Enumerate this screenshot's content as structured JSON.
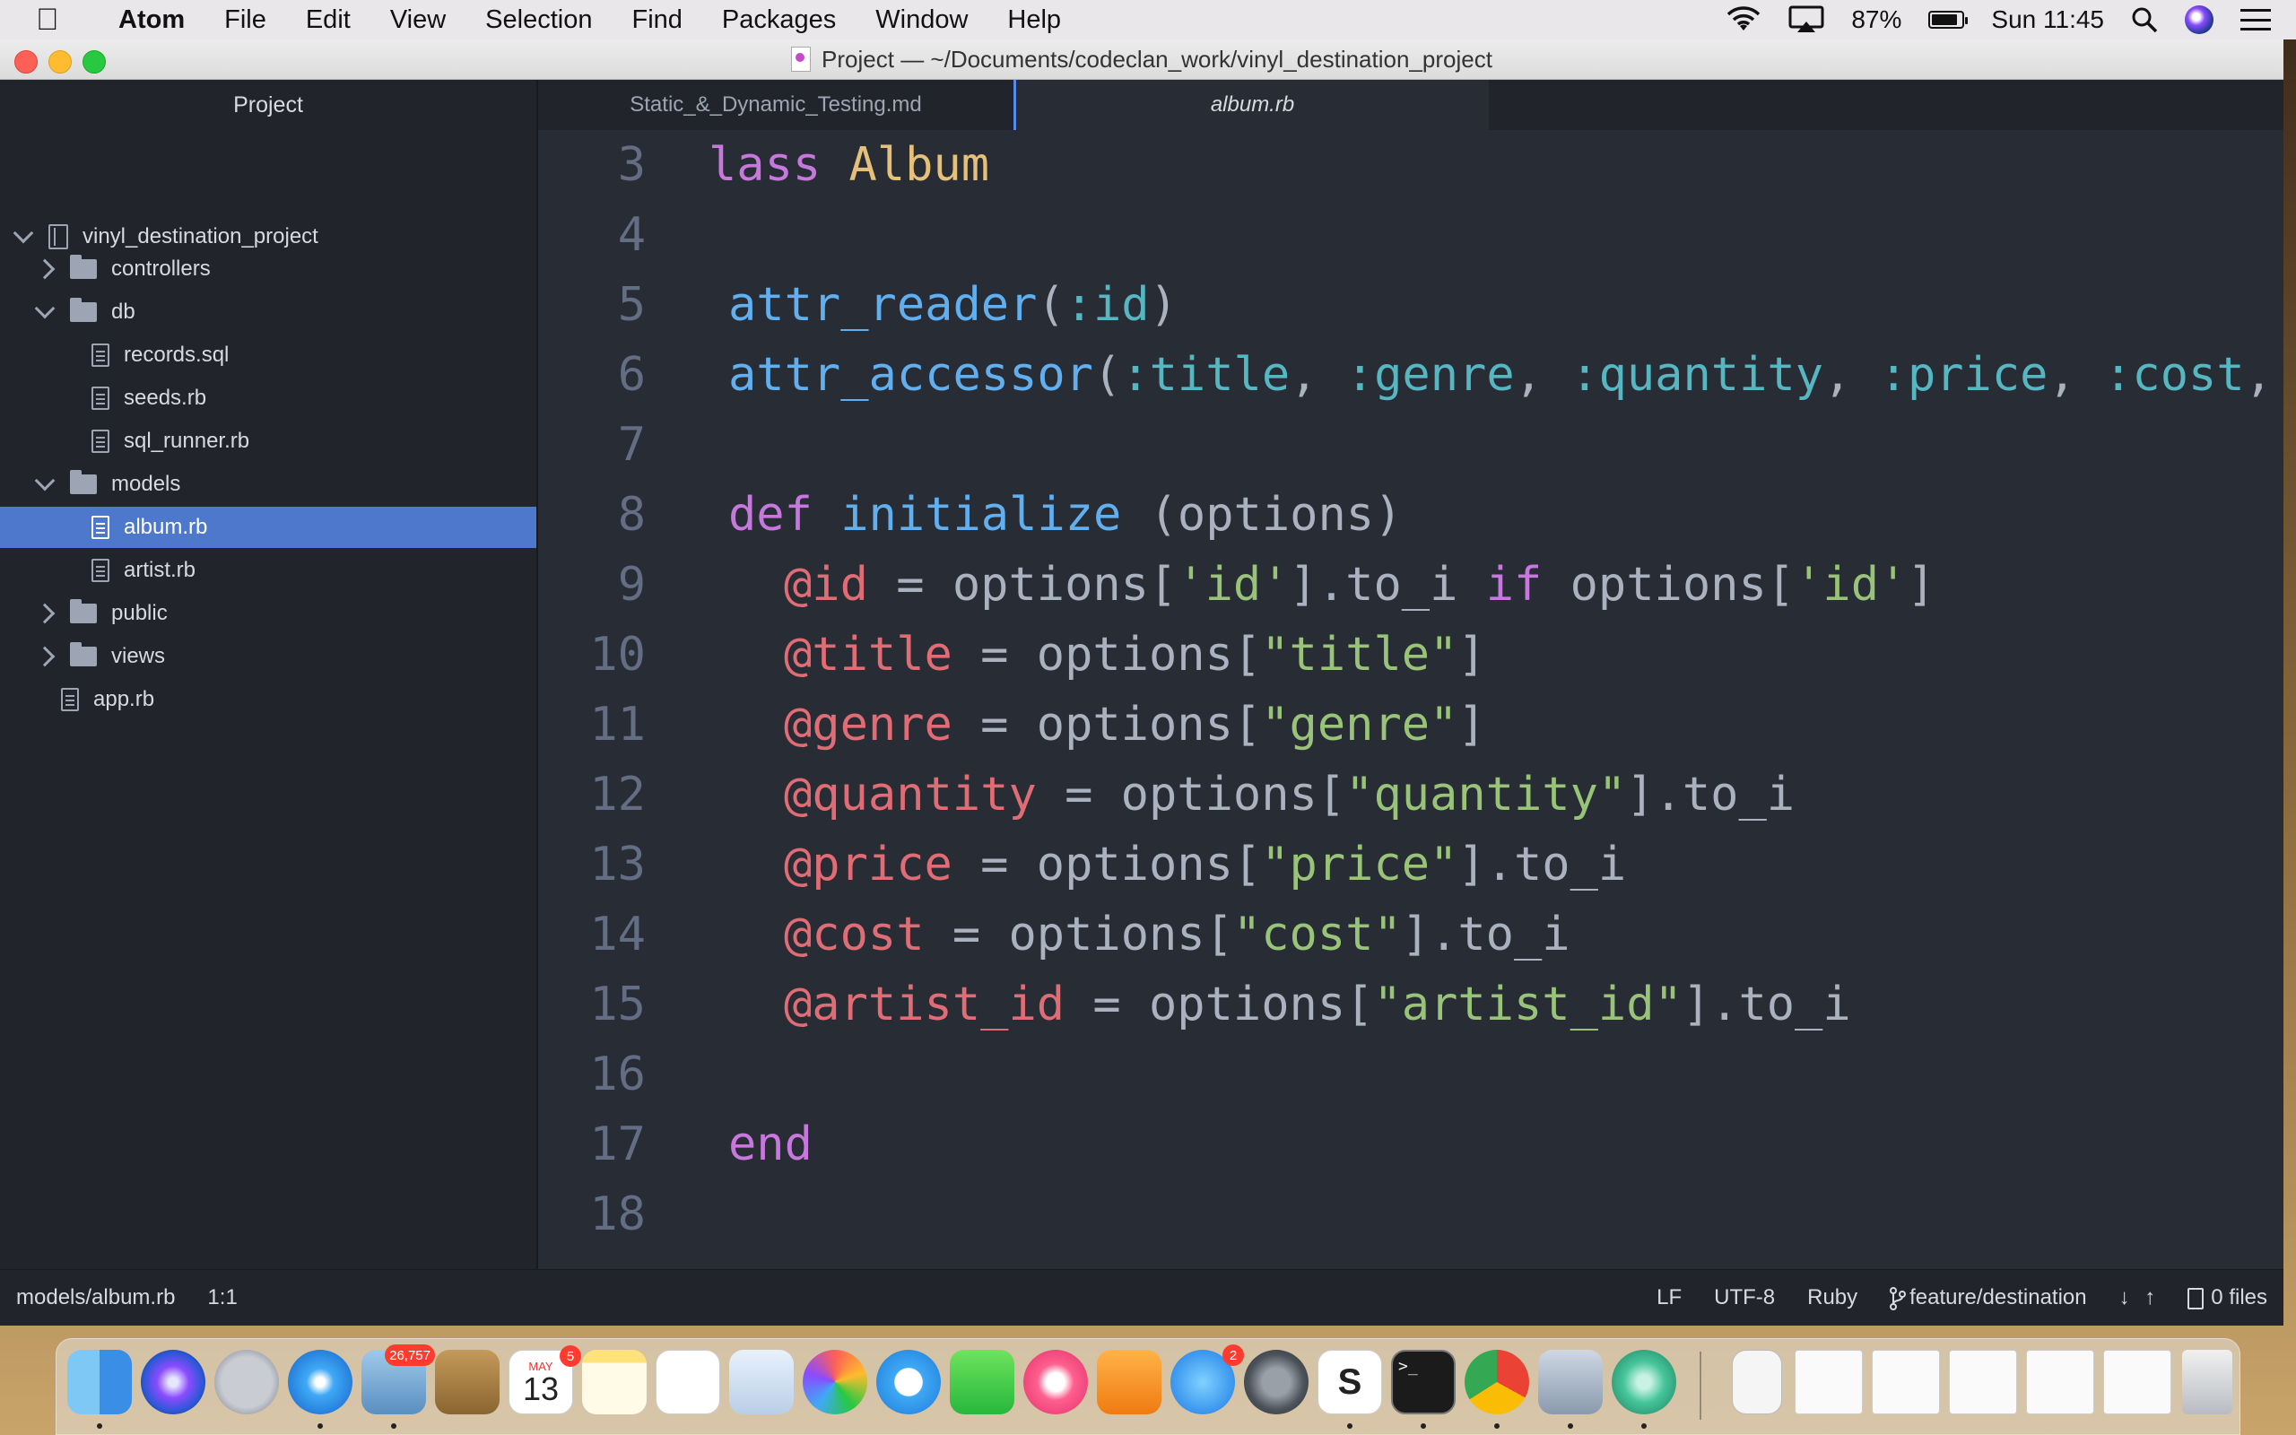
{
  "menubar": {
    "apple": "",
    "app": "Atom",
    "items": [
      "File",
      "Edit",
      "View",
      "Selection",
      "Find",
      "Packages",
      "Window",
      "Help"
    ],
    "battery": "87%",
    "battery_level": 0.87,
    "clock": "Sun 11:45"
  },
  "window": {
    "title": "Project — ~/Documents/codeclan_work/vinyl_destination_project"
  },
  "sidebar": {
    "header": "Project",
    "root": "vinyl_destination_project",
    "items": [
      {
        "label": "controllers",
        "type": "folder",
        "expanded": false
      },
      {
        "label": "db",
        "type": "folder",
        "expanded": true
      },
      {
        "label": "records.sql",
        "type": "file"
      },
      {
        "label": "seeds.rb",
        "type": "file"
      },
      {
        "label": "sql_runner.rb",
        "type": "file"
      },
      {
        "label": "models",
        "type": "folder",
        "expanded": true
      },
      {
        "label": "album.rb",
        "type": "file",
        "selected": true
      },
      {
        "label": "artist.rb",
        "type": "file"
      },
      {
        "label": "public",
        "type": "folder",
        "expanded": false
      },
      {
        "label": "views",
        "type": "folder",
        "expanded": false
      },
      {
        "label": "app.rb",
        "type": "file"
      }
    ]
  },
  "tabs": [
    {
      "label": "Static_&_Dynamic_Testing.md",
      "active": false
    },
    {
      "label": "album.rb",
      "active": true
    }
  ],
  "editor": {
    "line_numbers": [
      "3",
      "4",
      "5",
      "6",
      "7",
      "8",
      "9",
      "10",
      "11",
      "12",
      "13",
      "14",
      "15",
      "16",
      "17",
      "18"
    ],
    "lines": {
      "l3": {
        "kw": "lass",
        "cls": "Album"
      },
      "l5": {
        "fn": "attr_reader",
        "open": "(",
        "sym": ":id",
        "close": ")"
      },
      "l6": {
        "fn": "attr_accessor",
        "open": "(",
        "s1": ":title",
        "s2": ":genre",
        "s3": ":quantity",
        "s4": ":price",
        "s5": ":cost",
        "comma": ", ",
        "tail": ","
      },
      "l8": {
        "kw": "def",
        "fn": "initialize",
        "rest": "(options)"
      },
      "l9": {
        "ivar": "@id",
        "eq": " = options[",
        "str1": "'id'",
        "mid": "].to_i ",
        "kw": "if",
        "opt": " options[",
        "str2": "'id'",
        "end": "]"
      },
      "l10": {
        "ivar": "@title",
        "eq": " = options[",
        "str": "\"title\"",
        "end": "]"
      },
      "l11": {
        "ivar": "@genre",
        "eq": " = options[",
        "str": "\"genre\"",
        "end": "]"
      },
      "l12": {
        "ivar": "@quantity",
        "eq": " = options[",
        "str": "\"quantity\"",
        "end": "].to_i"
      },
      "l13": {
        "ivar": "@price",
        "eq": " = options[",
        "str": "\"price\"",
        "end": "].to_i"
      },
      "l14": {
        "ivar": "@cost",
        "eq": " = options[",
        "str": "\"cost\"",
        "end": "].to_i"
      },
      "l15": {
        "ivar": "@artist_id",
        "eq": " = options[",
        "str": "\"artist_id\"",
        "end": "].to_i"
      },
      "l17": {
        "kw": "end"
      }
    }
  },
  "statusbar": {
    "path": "models/album.rb",
    "cursor": "1:1",
    "line_ending": "LF",
    "encoding": "UTF-8",
    "grammar": "Ruby",
    "branch": "feature/destination",
    "fetch_down": "↓",
    "fetch_up": "↑",
    "files": "0 files"
  },
  "dock": {
    "mail_badge": "26,757",
    "calendar_month": "MAY",
    "calendar_day": "13",
    "calendar_badge": "5",
    "appstore_badge": "2",
    "terminal_prompt": ">_"
  },
  "colors": {
    "editor_bg": "#282c34",
    "sidebar_bg": "#21252b",
    "selection": "#4d78cc",
    "keyword": "#c678dd",
    "class": "#e5c07b",
    "function": "#61afef",
    "symbol": "#56b6c2",
    "ivar": "#e06c75",
    "string": "#98c379",
    "line_number": "#636d83"
  }
}
